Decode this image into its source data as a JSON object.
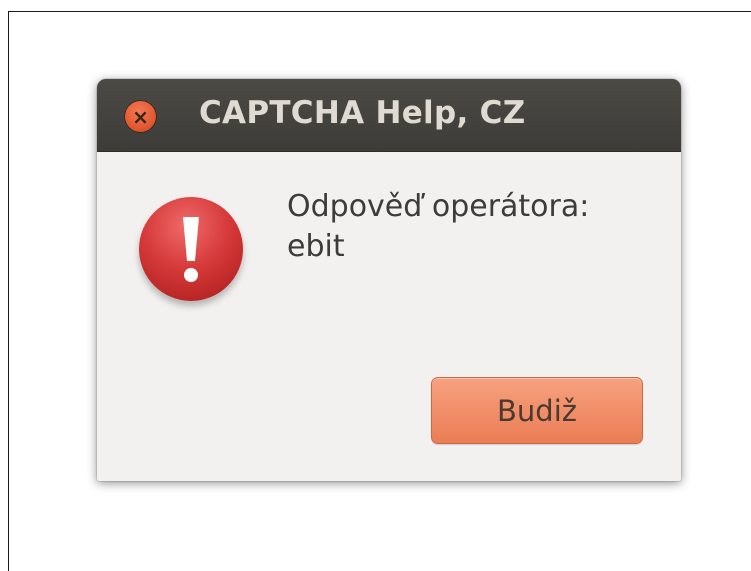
{
  "window": {
    "title": "CAPTCHA Help, CZ",
    "close_symbol": "×"
  },
  "icons": {
    "close": "close-icon",
    "error": "error-icon"
  },
  "message": {
    "line1": "Odpověď operátora:",
    "line2": "ebit"
  },
  "buttons": {
    "ok_label": "Budiž"
  },
  "colors": {
    "titlebar": "#3d3c38",
    "close_button": "#e45a33",
    "error_icon": "#d63a3a",
    "ok_button": "#ea7d55",
    "dialog_background": "#f2f1f0"
  }
}
